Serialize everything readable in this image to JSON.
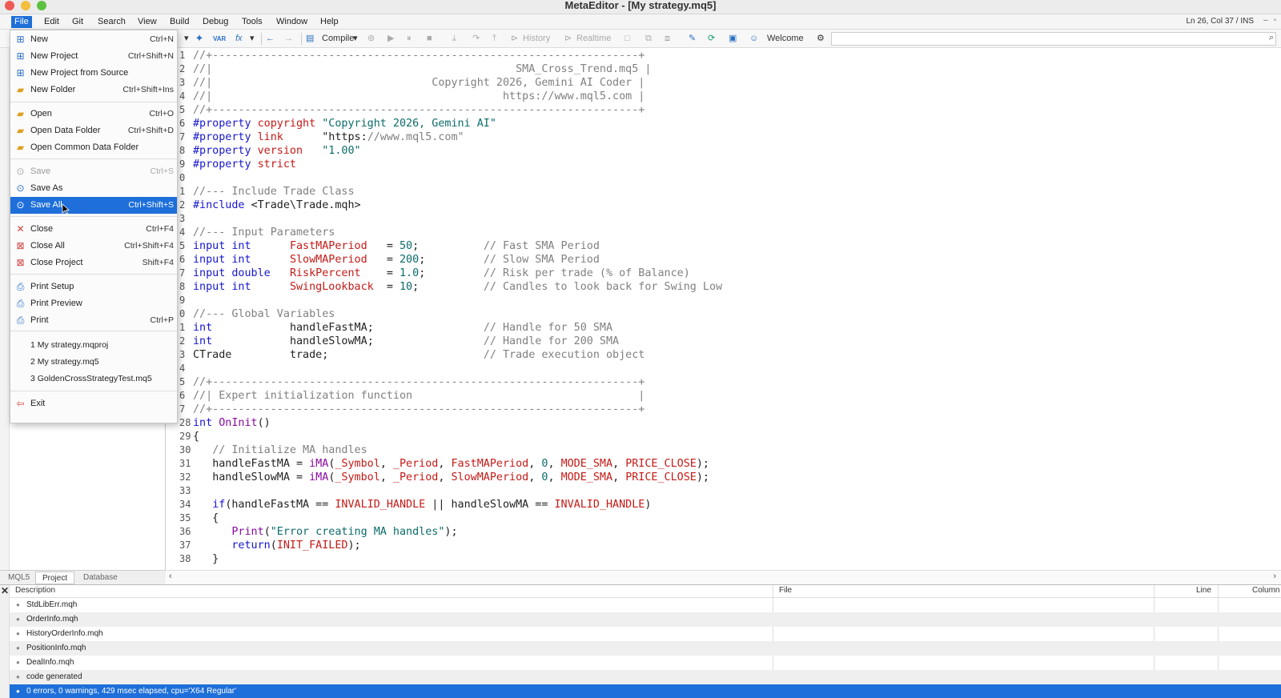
{
  "window": {
    "title": "MetaEditor - [My strategy.mq5]",
    "cursor_position": "Ln 26, Col 37  /  INS"
  },
  "menubar": {
    "items": [
      "File",
      "Edit",
      "Git",
      "Search",
      "View",
      "Build",
      "Debug",
      "Tools",
      "Window",
      "Help"
    ]
  },
  "toolbar": {
    "compile_label": "Compile",
    "history_label": "History",
    "realtime_label": "Realtime",
    "welcome_label": "Welcome",
    "var_label": "VAR",
    "fx_label": "fx"
  },
  "file_menu": {
    "items": [
      {
        "label": "New",
        "shortcut": "Ctrl+N",
        "icon": "new-file-icon",
        "state": "normal"
      },
      {
        "label": "New Project",
        "shortcut": "Ctrl+Shift+N",
        "icon": "new-project-icon",
        "state": "normal"
      },
      {
        "label": "New Project from Source",
        "shortcut": "",
        "icon": "new-project-source-icon",
        "state": "normal"
      },
      {
        "label": "New Folder",
        "shortcut": "Ctrl+Shift+Ins",
        "icon": "new-folder-icon",
        "state": "normal"
      },
      {
        "label": "Open",
        "shortcut": "Ctrl+O",
        "icon": "open-folder-icon",
        "state": "normal"
      },
      {
        "label": "Open Data Folder",
        "shortcut": "Ctrl+Shift+D",
        "icon": "data-folder-icon",
        "state": "normal"
      },
      {
        "label": "Open Common Data Folder",
        "shortcut": "",
        "icon": "common-folder-icon",
        "state": "normal"
      },
      {
        "label": "Save",
        "shortcut": "Ctrl+S",
        "icon": "save-icon",
        "state": "disabled"
      },
      {
        "label": "Save As",
        "shortcut": "",
        "icon": "save-as-icon",
        "state": "normal"
      },
      {
        "label": "Save All",
        "shortcut": "Ctrl+Shift+S",
        "icon": "save-all-icon",
        "state": "highlighted"
      },
      {
        "label": "Close",
        "shortcut": "Ctrl+F4",
        "icon": "close-icon",
        "state": "normal"
      },
      {
        "label": "Close All",
        "shortcut": "Ctrl+Shift+F4",
        "icon": "close-all-icon",
        "state": "normal"
      },
      {
        "label": "Close Project",
        "shortcut": "Shift+F4",
        "icon": "close-project-icon",
        "state": "normal"
      },
      {
        "label": "Print Setup",
        "shortcut": "",
        "icon": "print-setup-icon",
        "state": "normal"
      },
      {
        "label": "Print Preview",
        "shortcut": "",
        "icon": "print-preview-icon",
        "state": "normal"
      },
      {
        "label": "Print",
        "shortcut": "Ctrl+P",
        "icon": "printer-icon",
        "state": "normal"
      }
    ],
    "recent": [
      "1 My strategy.mqproj",
      "2 My strategy.mq5",
      "3 GoldenCrossStrategyTest.mq5"
    ],
    "exit_label": "Exit"
  },
  "navigator": {
    "tabs": [
      "MQL5",
      "Project",
      "Database"
    ],
    "selected_tab": "Project"
  },
  "editor": {
    "lines": [
      {
        "n": "1",
        "text": "//+------------------------------------------------------------------+"
      },
      {
        "n": "2",
        "text": "//|                                               SMA_Cross_Trend.mq5 |"
      },
      {
        "n": "3",
        "text": "//|                                  Copyright 2026, Gemini AI Coder |"
      },
      {
        "n": "4",
        "text": "//|                                             https://www.mql5.com |"
      },
      {
        "n": "5",
        "text": "//+------------------------------------------------------------------+"
      },
      {
        "n": "6",
        "text": "#property copyright \"Copyright 2026, Gemini AI\""
      },
      {
        "n": "7",
        "text": "#property link      \"https://www.mql5.com\""
      },
      {
        "n": "8",
        "text": "#property version   \"1.00\""
      },
      {
        "n": "9",
        "text": "#property strict"
      },
      {
        "n": "0",
        "text": ""
      },
      {
        "n": "1",
        "text": "//--- Include Trade Class"
      },
      {
        "n": "2",
        "text": "#include <Trade\\Trade.mqh>"
      },
      {
        "n": "3",
        "text": ""
      },
      {
        "n": "4",
        "text": "//--- Input Parameters"
      },
      {
        "n": "5",
        "text": "input int      FastMAPeriod   = 50;          // Fast SMA Period"
      },
      {
        "n": "6",
        "text": "input int      SlowMAPeriod   = 200;         // Slow SMA Period"
      },
      {
        "n": "7",
        "text": "input double   RiskPercent    = 1.0;         // Risk per trade (% of Balance)"
      },
      {
        "n": "8",
        "text": "input int      SwingLookback  = 10;          // Candles to look back for Swing Low"
      },
      {
        "n": "9",
        "text": ""
      },
      {
        "n": "0",
        "text": "//--- Global Variables"
      },
      {
        "n": "1",
        "text": "int            handleFastMA;                 // Handle for 50 SMA"
      },
      {
        "n": "2",
        "text": "int            handleSlowMA;                 // Handle for 200 SMA"
      },
      {
        "n": "3",
        "text": "CTrade         trade;                        // Trade execution object"
      },
      {
        "n": "4",
        "text": ""
      },
      {
        "n": "5",
        "text": "//+------------------------------------------------------------------+"
      },
      {
        "n": "6",
        "text": "//| Expert initialization function                                   |"
      },
      {
        "n": "7",
        "text": "//+------------------------------------------------------------------+"
      },
      {
        "n": "28",
        "text": "int OnInit()"
      },
      {
        "n": "29",
        "text": "{"
      },
      {
        "n": "30",
        "text": "   // Initialize MA handles"
      },
      {
        "n": "31",
        "text": "   handleFastMA = iMA(_Symbol, _Period, FastMAPeriod, 0, MODE_SMA, PRICE_CLOSE);"
      },
      {
        "n": "32",
        "text": "   handleSlowMA = iMA(_Symbol, _Period, SlowMAPeriod, 0, MODE_SMA, PRICE_CLOSE);"
      },
      {
        "n": "33",
        "text": ""
      },
      {
        "n": "34",
        "text": "   if(handleFastMA == INVALID_HANDLE || handleSlowMA == INVALID_HANDLE)"
      },
      {
        "n": "35",
        "text": "   {"
      },
      {
        "n": "36",
        "text": "      Print(\"Error creating MA handles\");"
      },
      {
        "n": "37",
        "text": "      return(INIT_FAILED);"
      },
      {
        "n": "38",
        "text": "   }"
      }
    ]
  },
  "errors": {
    "columns": [
      "Description",
      "File",
      "Line",
      "Column"
    ],
    "rows": [
      "StdLibErr.mqh",
      "OrderInfo.mqh",
      "HistoryOrderInfo.mqh",
      "PositionInfo.mqh",
      "DealInfo.mqh",
      "code generated",
      "0 errors, 0 warnings, 429 msec elapsed, cpu='X64 Regular'"
    ]
  },
  "colors": {
    "accent": "#1e6fd9",
    "comment": "#808080",
    "keyword": "#1717d0",
    "string": "#0b6c6b",
    "identifier": "#c41a16",
    "function": "#8b0aa3"
  }
}
